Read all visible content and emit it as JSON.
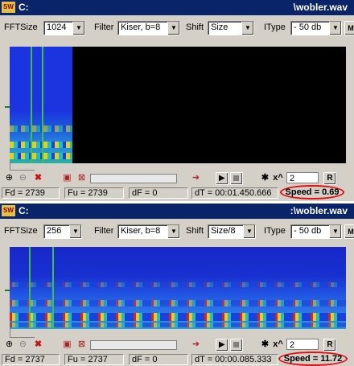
{
  "windows": [
    {
      "title_drive": "C:",
      "title_file": "\\wobler.wav",
      "app_icon_text": "SW",
      "fftsize_label": "FFTSize",
      "fftsize_value": "1024",
      "filter_label": "Filter",
      "filter_value": "Kiser, b=8",
      "shift_label": "Shift",
      "shift_value": "Size",
      "itype_label": "IType",
      "itype_value": "- 50 db",
      "power_input": "2",
      "power_label": "x^",
      "r_button": "R",
      "status": {
        "fd": "Fd = 2739",
        "fu": "Fu = 2739",
        "df": "dF = 0",
        "dt": "dT = 00:01.450.666",
        "speed": "Speed = 0.69"
      }
    },
    {
      "title_drive": "C:",
      "title_file": ":\\wobler.wav",
      "app_icon_text": "SW",
      "fftsize_label": "FFTSize",
      "fftsize_value": "256",
      "filter_label": "Filter",
      "filter_value": "Kiser, b=8",
      "shift_label": "Shift",
      "shift_value": "Size/8",
      "itype_label": "IType",
      "itype_value": "- 50 db",
      "power_input": "2",
      "power_label": "x^",
      "r_button": "R",
      "status": {
        "fd": "Fd = 2737",
        "fu": "Fu = 2737",
        "df": "dF = 0",
        "dt": "dT = 00:00.085.333",
        "speed": "Speed = 11.72"
      }
    }
  ],
  "colors": {
    "titlebar": "#0a246a",
    "spectrogram_bg": "#1a30d8",
    "cursor": "#40c040",
    "highlight_ellipse": "#e01010"
  },
  "icons": [
    "app-icon",
    "zoom-in-icon",
    "zoom-out-icon",
    "cancel-icon",
    "save-icon",
    "close-image-icon",
    "play-icon",
    "stop-icon",
    "asterisk-icon",
    "dropdown-arrow-icon"
  ]
}
